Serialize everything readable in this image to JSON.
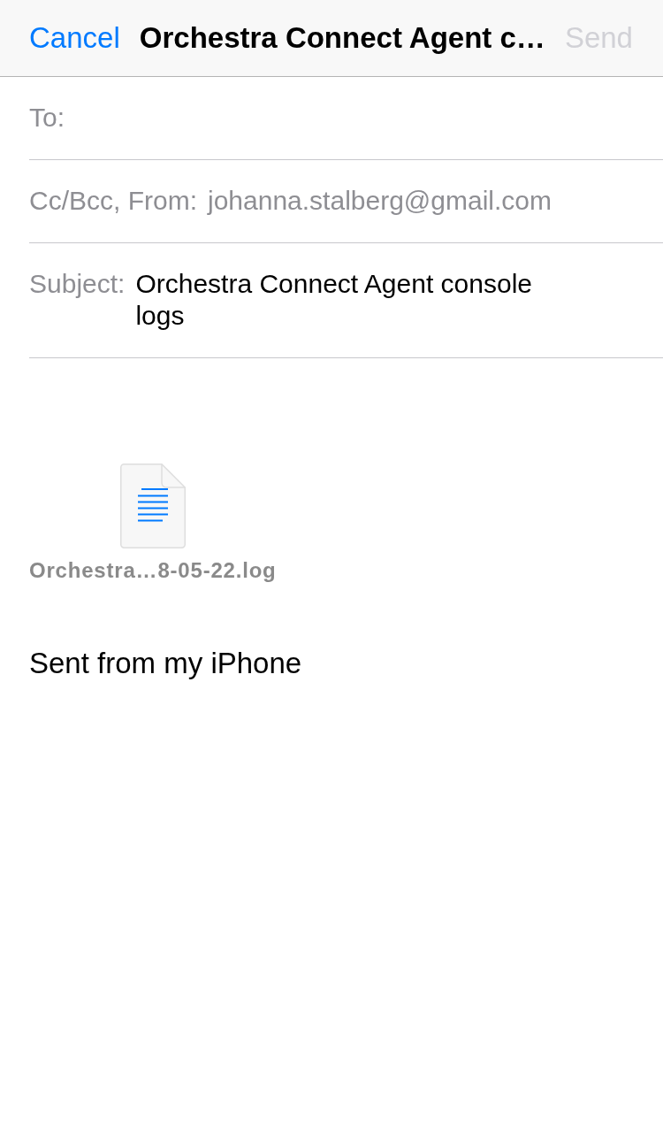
{
  "nav": {
    "cancel": "Cancel",
    "title": "Orchestra Connect Agent c…",
    "send": {
      "label": "Send",
      "disabled": true
    }
  },
  "fields": [
    {
      "kind": "recipients",
      "label": "To:"
    },
    {
      "kind": "summary",
      "label": "Cc/Bcc, From:",
      "value": "johanna.stalberg@gmail.com"
    },
    {
      "kind": "text",
      "label": "Subject:",
      "value": "Orchestra Connect Agent console logs"
    }
  ],
  "attachment": {
    "filename": "Orchestra…8-05-22.log"
  },
  "body": {
    "signature": "Sent from my iPhone"
  }
}
